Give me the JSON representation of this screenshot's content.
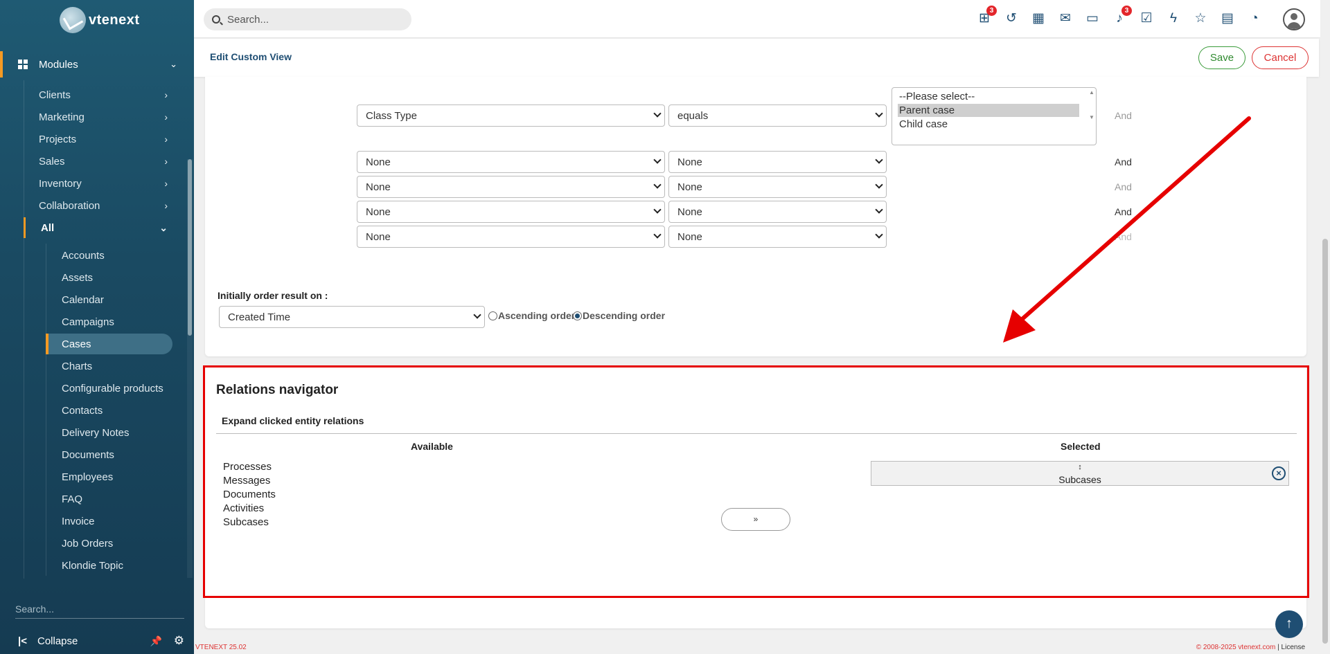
{
  "app": {
    "logo_text": "vtenext"
  },
  "sidebar": {
    "modules_label": "Modules",
    "items": [
      {
        "label": "Clients"
      },
      {
        "label": "Marketing"
      },
      {
        "label": "Projects"
      },
      {
        "label": "Sales"
      },
      {
        "label": "Inventory"
      },
      {
        "label": "Collaboration"
      },
      {
        "label": "All"
      }
    ],
    "sub_items": [
      {
        "label": "Accounts"
      },
      {
        "label": "Assets"
      },
      {
        "label": "Calendar"
      },
      {
        "label": "Campaigns"
      },
      {
        "label": "Cases"
      },
      {
        "label": "Charts"
      },
      {
        "label": "Configurable products"
      },
      {
        "label": "Contacts"
      },
      {
        "label": "Delivery Notes"
      },
      {
        "label": "Documents"
      },
      {
        "label": "Employees"
      },
      {
        "label": "FAQ"
      },
      {
        "label": "Invoice"
      },
      {
        "label": "Job Orders"
      },
      {
        "label": "Klondie Topic"
      }
    ],
    "search_placeholder": "Search...",
    "collapse_label": "Collapse"
  },
  "topbar": {
    "search_placeholder": "Search...",
    "icons": [
      {
        "name": "processes-icon",
        "badge": "3"
      },
      {
        "name": "history-icon"
      },
      {
        "name": "calendar-icon"
      },
      {
        "name": "mail-icon"
      },
      {
        "name": "chat-icon"
      },
      {
        "name": "notifications-icon",
        "badge": "3"
      },
      {
        "name": "tasks-icon"
      },
      {
        "name": "quick-actions-icon"
      },
      {
        "name": "favorites-icon"
      },
      {
        "name": "documents-icon"
      },
      {
        "name": "timer-icon"
      }
    ]
  },
  "edit_header": {
    "title": "Edit Custom View",
    "save_label": "Save",
    "cancel_label": "Cancel"
  },
  "filters": {
    "rows": [
      {
        "field": "Class Type",
        "operator": "equals",
        "and_label": "And"
      },
      {
        "field": "None",
        "operator": "None",
        "and_label": "And"
      },
      {
        "field": "None",
        "operator": "None",
        "and_label": "And"
      },
      {
        "field": "None",
        "operator": "None",
        "and_label": "And"
      },
      {
        "field": "None",
        "operator": "None",
        "and_label": "And"
      }
    ],
    "value_options": [
      "--Please select--",
      "Parent case",
      "Child case"
    ],
    "value_selected": "Parent case"
  },
  "order": {
    "label": "Initially order result on :",
    "field": "Created Time",
    "ascending_label": "Ascending order",
    "descending_label": "Descending order",
    "selected": "descending"
  },
  "relations": {
    "title": "Relations navigator",
    "subtitle": "Expand clicked entity relations",
    "available_header": "Available",
    "selected_header": "Selected",
    "available": [
      "Processes",
      "Messages",
      "Documents",
      "Activities",
      "Subcases"
    ],
    "selected": [
      "Subcases"
    ],
    "move_button_label": "»"
  },
  "footer": {
    "version": "VTENEXT 25.02",
    "copyright": "© 2008-2025 vtenext.com",
    "license_label": "License"
  },
  "colors": {
    "accent": "#f59a23",
    "brand": "#1f4e73",
    "highlight_frame": "#e60000"
  }
}
